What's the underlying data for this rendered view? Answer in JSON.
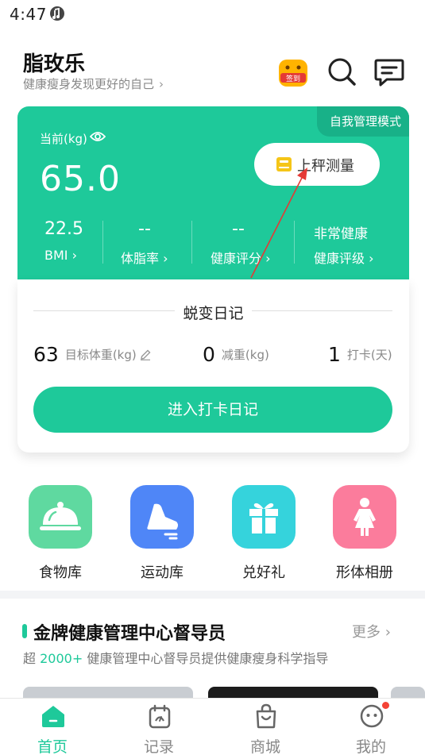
{
  "status_bar": {
    "time": "4:47"
  },
  "header": {
    "title": "脂玫乐",
    "subtitle": "健康瘦身发现更好的自己",
    "checkin_label": "签到"
  },
  "weight_card": {
    "mode_badge": "自我管理模式",
    "current_label": "当前(kg)",
    "current_weight": "65.0",
    "scale_button": "上秤测量",
    "metrics": [
      {
        "value": "22.5",
        "label": "BMI"
      },
      {
        "value": "--",
        "label": "体脂率"
      },
      {
        "value": "--",
        "label": "健康评分"
      },
      {
        "value": "非常健康",
        "label": "健康评级"
      }
    ]
  },
  "diary": {
    "title": "蜕变日记",
    "target_weight": "63",
    "target_label": "目标体重(kg)",
    "lost_weight": "0",
    "lost_label": "减重(kg)",
    "checkin_days": "1",
    "checkin_label": "打卡(天)",
    "button": "进入打卡日记"
  },
  "features": [
    {
      "label": "食物库",
      "icon": "food-cloche-icon",
      "color": "#5fd9a0"
    },
    {
      "label": "运动库",
      "icon": "sneaker-icon",
      "color": "#4f86f7"
    },
    {
      "label": "兑好礼",
      "icon": "gift-icon",
      "color": "#35d3dc"
    },
    {
      "label": "形体相册",
      "icon": "woman-figure-icon",
      "color": "#fb7c9c"
    }
  ],
  "supervisor_section": {
    "title": "金牌健康管理中心督导员",
    "more": "更多",
    "desc_prefix": "超",
    "desc_highlight": "2000+",
    "desc_suffix": "健康管理中心督导员提供健康瘦身科学指导"
  },
  "tabbar": [
    {
      "label": "首页",
      "active": true
    },
    {
      "label": "记录",
      "active": false
    },
    {
      "label": "商城",
      "active": false
    },
    {
      "label": "我的",
      "active": false,
      "badge": true
    }
  ],
  "colors": {
    "brand_green": "#1ec99a",
    "badge_green": "#18b188",
    "annotation_red": "#e53935"
  }
}
